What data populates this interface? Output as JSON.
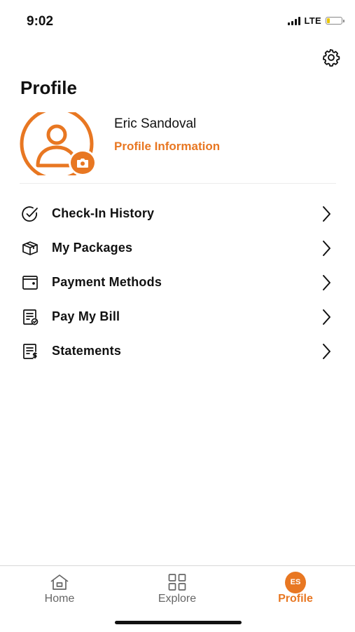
{
  "status_bar": {
    "time": "9:02",
    "network": "LTE",
    "battery_level": 0.2,
    "battery_color": "#e9c400"
  },
  "header": {
    "title": "Profile",
    "settings_icon": "gear-icon"
  },
  "user": {
    "name": "Eric Sandoval",
    "profile_link": "Profile Information",
    "avatar_icon": "user-icon",
    "camera_icon": "camera-icon"
  },
  "menu": {
    "items": [
      {
        "label": "Check-In History",
        "icon": "check-circle-icon"
      },
      {
        "label": "My Packages",
        "icon": "package-icon"
      },
      {
        "label": "Payment Methods",
        "icon": "wallet-icon"
      },
      {
        "label": "Pay My Bill",
        "icon": "bill-check-icon"
      },
      {
        "label": "Statements",
        "icon": "statement-dollar-icon"
      }
    ]
  },
  "tab_bar": {
    "tabs": [
      {
        "label": "Home",
        "icon": "home-icon",
        "active": false
      },
      {
        "label": "Explore",
        "icon": "grid-icon",
        "active": false
      },
      {
        "label": "Profile",
        "initials": "ES",
        "active": true
      }
    ]
  },
  "colors": {
    "accent": "#e87722",
    "text": "#111111",
    "inactive": "#666666"
  }
}
